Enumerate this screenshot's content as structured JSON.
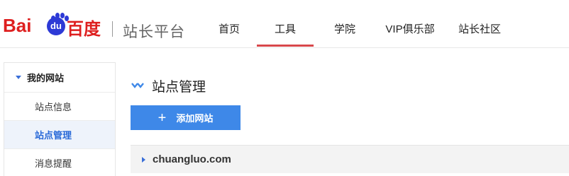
{
  "brand": {
    "logo_bai": "Bai",
    "logo_du": "du",
    "logo_cn": "百度",
    "platform": "站长平台",
    "colors": {
      "red": "#de1f1f",
      "blue": "#2d3ad6"
    }
  },
  "nav": {
    "items": [
      {
        "label": "首页",
        "active": false
      },
      {
        "label": "工具",
        "active": true
      },
      {
        "label": "学院",
        "active": false
      },
      {
        "label": "VIP俱乐部",
        "active": false
      },
      {
        "label": "站长社区",
        "active": false
      }
    ],
    "active_color": "#d8484b"
  },
  "sidebar": {
    "section": "我的网站",
    "items": [
      {
        "label": "站点信息",
        "active": false
      },
      {
        "label": "站点管理",
        "active": true
      },
      {
        "label": "消息提醒",
        "active": false
      }
    ]
  },
  "main": {
    "title": "站点管理",
    "add_button": "添加网站",
    "accent": "#3e88e8",
    "sites": [
      {
        "domain": "chuangluo.com"
      }
    ]
  }
}
